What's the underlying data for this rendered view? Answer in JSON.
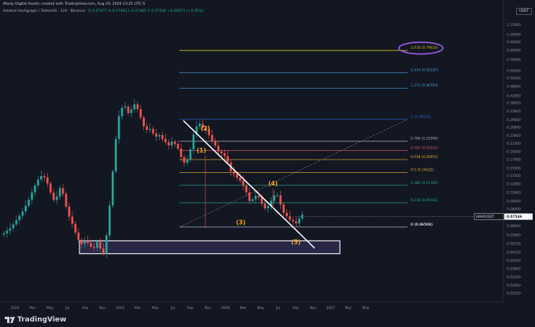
{
  "header": {
    "credit": "Manly Digital Assets created with TradingView.com, Aug 29, 2026 13:25 UTC-5",
    "symbol": "Hedera Hashgraph / TetherUS · 12h · Binance",
    "ohlc": "O 0.07477  H 0.07481  L 0.07465  C 0.07546  +0.00071 (+0.95%)"
  },
  "unit_label": "USDT",
  "brand": {
    "name": "TradingView",
    "icon": "tradingview-logo-icon"
  },
  "colors": {
    "background": "#131722",
    "up": "#26a69a",
    "down": "#ef5350",
    "wave": "#f5a623",
    "price_tag": "#131722"
  },
  "chart_data": {
    "type": "line",
    "series": [
      {
        "values": [
          0.0596,
          0.0618,
          0.0639,
          0.0676,
          0.0718,
          0.0765,
          0.0812,
          0.088,
          0.0959,
          0.1065,
          0.1174,
          0.1276,
          0.1342,
          0.1318,
          0.1207,
          0.1062,
          0.0955,
          0.1004,
          0.113,
          0.1044,
          0.0869,
          0.0755,
          0.0681,
          0.0602,
          0.0543,
          0.0512,
          0.0535,
          0.0519,
          0.0492,
          0.0485,
          0.0528,
          0.048,
          0.0446,
          0.0578,
          0.0883,
          0.1433,
          0.2269,
          0.3142,
          0.3547,
          0.3601,
          0.328,
          0.3461,
          0.3719,
          0.3466,
          0.3078,
          0.2723,
          0.2587,
          0.2622,
          0.246,
          0.2352,
          0.24,
          0.2273,
          0.2173,
          0.2075,
          0.219,
          0.2117,
          0.1981,
          0.1758,
          0.162,
          0.1693,
          0.1961,
          0.2421,
          0.2713,
          0.2816,
          0.2664,
          0.2597,
          0.2402,
          0.2215,
          0.2066,
          0.1904,
          0.1855,
          0.1781,
          0.1631,
          0.1435,
          0.1382,
          0.1311,
          0.126,
          0.117,
          0.1066,
          0.0942,
          0.0964,
          0.1014,
          0.0992,
          0.0907,
          0.0849,
          0.0875,
          0.0945,
          0.1021,
          0.1021,
          0.0896,
          0.0797,
          0.0759,
          0.072,
          0.0706,
          0.0685,
          0.0735,
          0.0777
        ]
      }
    ],
    "x_axis": {
      "labels": [
        "2024",
        "Mar",
        "May",
        "Jul",
        "Sep",
        "Nov",
        "2025",
        "Mar",
        "May",
        "Jul",
        "Sep",
        "Nov",
        "2026",
        "Mar",
        "May",
        "Jul",
        "Sep",
        "Nov",
        "2027",
        "Mar",
        "May"
      ]
    },
    "y_axis": {
      "scale": "log",
      "ylim": [
        0.0225,
        1.25
      ],
      "tick_labels": [
        "1.15000",
        "1.00000",
        "0.90000",
        "0.80000",
        "0.70000",
        "0.60000",
        "0.54000",
        "0.48000",
        "0.42000",
        "0.38000",
        "0.33800",
        "0.29800",
        "0.26800",
        "0.23800",
        "0.21300",
        "0.19000",
        "0.17000",
        "0.15000",
        "0.13500",
        "0.12000",
        "0.10600",
        "0.09400",
        "0.08400",
        "0.07450",
        "0.06600",
        "0.05800",
        "0.05150",
        "0.04550",
        "0.04050",
        "0.03600",
        "0.03200",
        "0.02850",
        "0.02550"
      ]
    },
    "fib_levels": [
      {
        "label": "1.618 (0.79828)",
        "value": 0.79828,
        "color": "#c3b71f"
      },
      {
        "label": "1.414 (0.58197)",
        "value": 0.58197,
        "color": "#4a9ed6"
      },
      {
        "label": "1.272 (0.46704)",
        "value": 0.46704,
        "color": "#4a9ed6"
      },
      {
        "label": "1 (0.30024)",
        "value": 0.30024,
        "color": "#2b62c9"
      },
      {
        "label": "0.786 (0.21996)",
        "value": 0.21996,
        "color": "#a7b0c2"
      },
      {
        "label": "0.702 (0.19312)",
        "value": 0.19312,
        "color": "#e05a6a"
      },
      {
        "label": "0.618 (0.16955)",
        "value": 0.16955,
        "color": "#e8b13a"
      },
      {
        "label": "0.5 (0.14122)",
        "value": 0.14122,
        "color": "#e8b13a"
      },
      {
        "label": "0.382 (0.11765)",
        "value": 0.11765,
        "color": "#27a890"
      },
      {
        "label": "0.236 (0.09181)",
        "value": 0.09181,
        "color": "#27a890"
      },
      {
        "label": "0 (0.06508)",
        "value": 0.06508,
        "color": "#a7b0c2"
      }
    ],
    "wave_labels": [
      {
        "label": "(2)",
        "value": 0.264
      },
      {
        "label": "(1)",
        "value": 0.193
      },
      {
        "label": "(3)",
        "value": 0.0695
      },
      {
        "label": "(4)",
        "value": 0.121
      },
      {
        "label": "(5)",
        "value": 0.0525
      }
    ],
    "current_price": {
      "label": "HBARUSDT",
      "value_label": "0.07546",
      "value": 0.07546
    },
    "support_zone": {
      "top": 0.0535,
      "bottom": 0.0446
    },
    "highlight": {
      "label": "1.618 (0.79828)"
    }
  }
}
